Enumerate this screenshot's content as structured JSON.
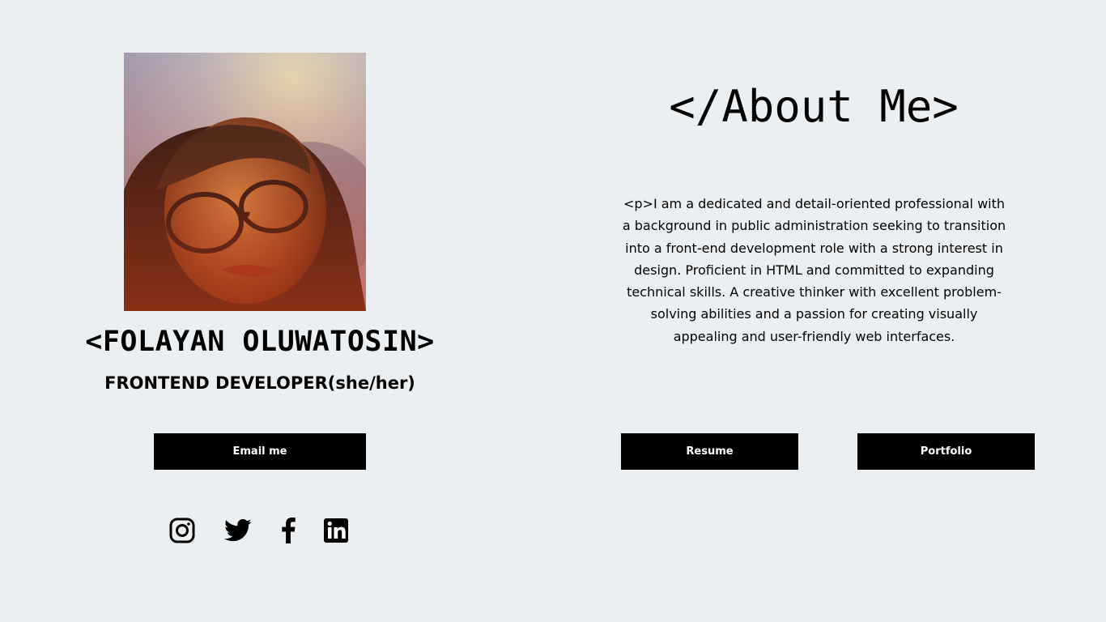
{
  "profile": {
    "photo_alt": "profile photo",
    "name": "<FOLAYAN OLUWATOSIN>",
    "role": "FRONTEND DEVELOPER(she/her)"
  },
  "buttons": {
    "email": "Email me",
    "resume": "Resume",
    "portfolio": "Portfolio"
  },
  "social": [
    {
      "icon": "instagram-icon"
    },
    {
      "icon": "twitter-icon"
    },
    {
      "icon": "facebook-icon"
    },
    {
      "icon": "linkedin-icon"
    }
  ],
  "about": {
    "title": "</About Me>",
    "text": "<p>I am a dedicated and detail-oriented professional with a background in public administration seeking to transition into a front-end development role with a strong interest in design. Proficient in HTML and committed to expanding technical skills. A creative thinker with excellent problem-solving abilities and a passion for creating visually appealing and user-friendly web interfaces."
  },
  "colors": {
    "background": "#ebeff2",
    "button_bg": "#000000",
    "button_text": "#ffffff"
  }
}
